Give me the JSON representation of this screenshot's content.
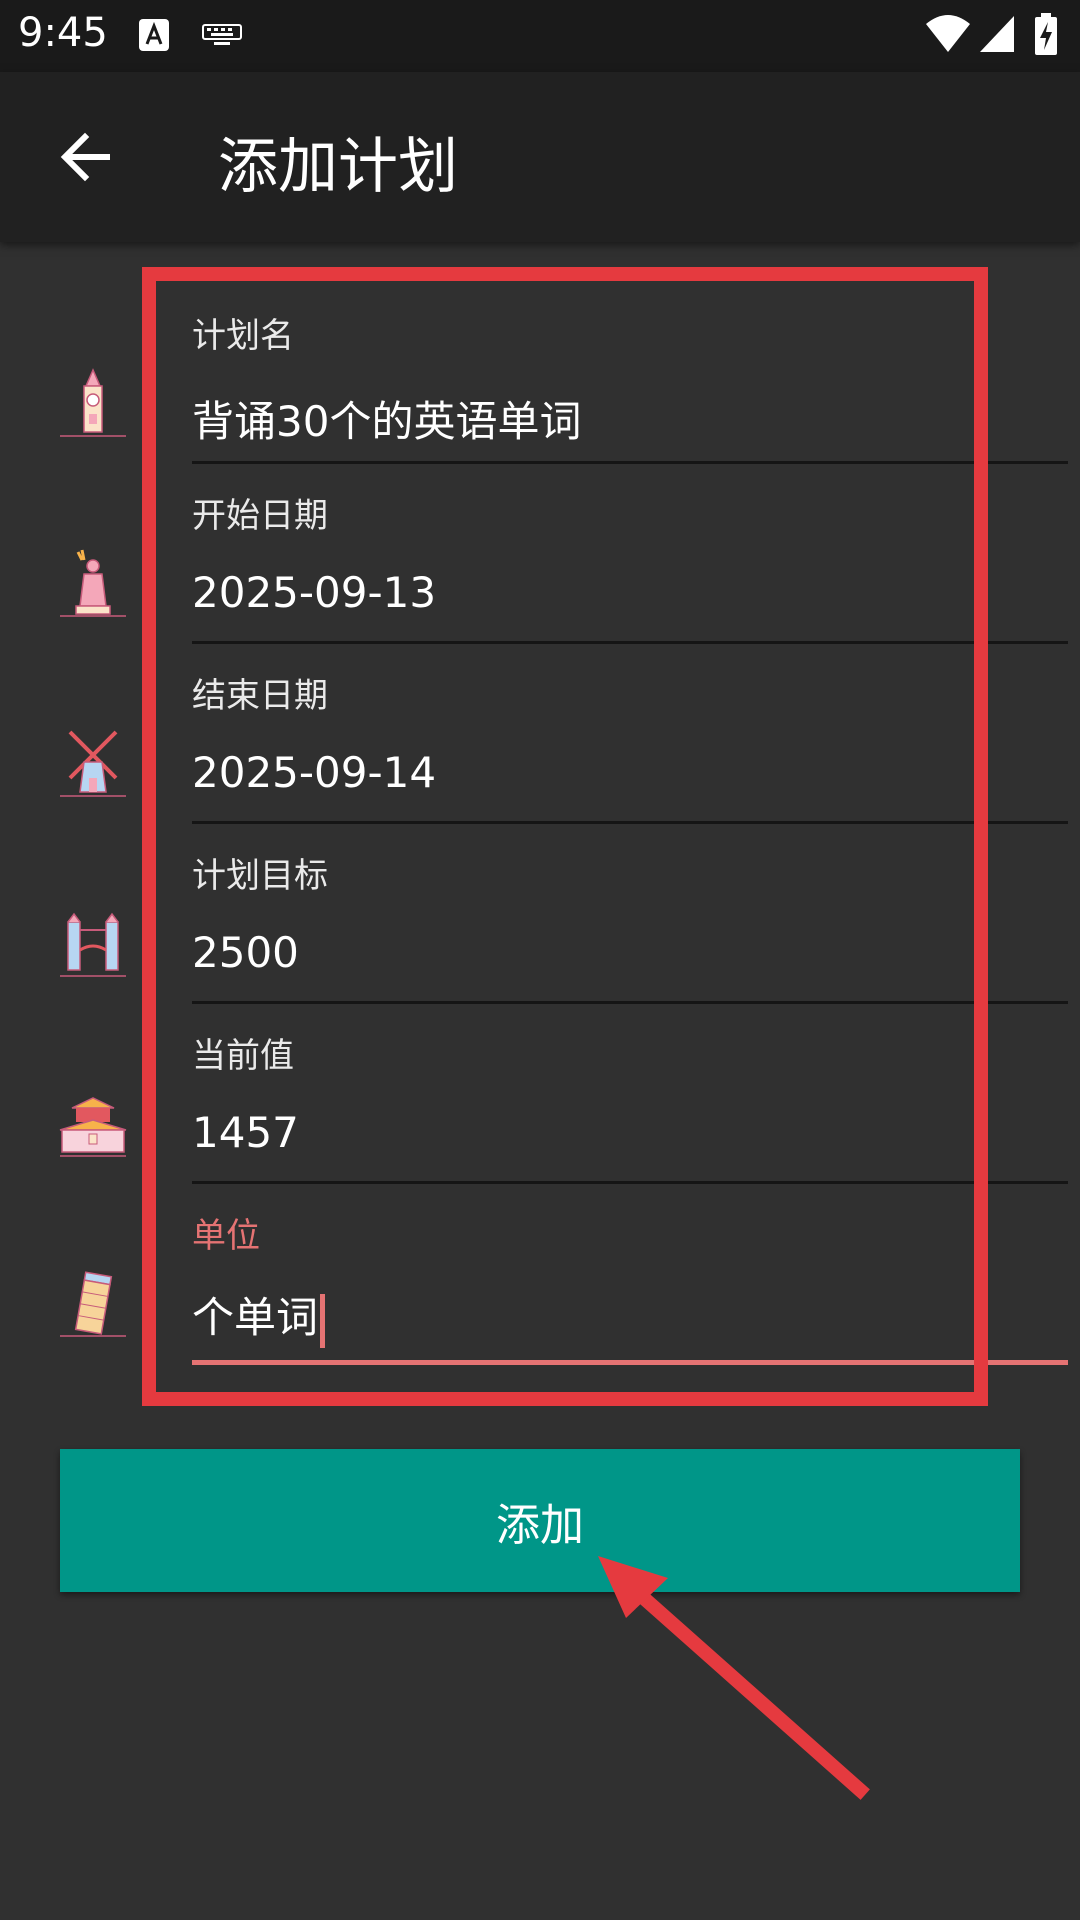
{
  "status_bar": {
    "time": "9:45",
    "icons": [
      "text-input-icon",
      "keyboard-icon",
      "wifi-icon",
      "signal-icon",
      "battery-charging-icon"
    ]
  },
  "app_bar": {
    "back_icon": "arrow-left-icon",
    "title": "添加计划"
  },
  "form": {
    "fields": [
      {
        "label": "计划名",
        "value": "背诵30个的英语单词",
        "icon": "clock-tower-icon"
      },
      {
        "label": "开始日期",
        "value": "2025-09-13",
        "icon": "statue-of-liberty-icon"
      },
      {
        "label": "结束日期",
        "value": "2025-09-14",
        "icon": "windmill-icon"
      },
      {
        "label": "计划目标",
        "value": "2500",
        "icon": "tower-bridge-icon"
      },
      {
        "label": "当前值",
        "value": "1457",
        "icon": "gate-tower-icon"
      },
      {
        "label": "单位",
        "value": "个单词",
        "icon": "leaning-tower-icon",
        "focused": true
      }
    ]
  },
  "add_button": {
    "label": "添加"
  },
  "colors": {
    "background": "#303030",
    "app_bar": "#212121",
    "status_bar": "#1a1a1a",
    "accent": "#009688",
    "focus": "#e57373",
    "annotation": "#e53a3f"
  }
}
